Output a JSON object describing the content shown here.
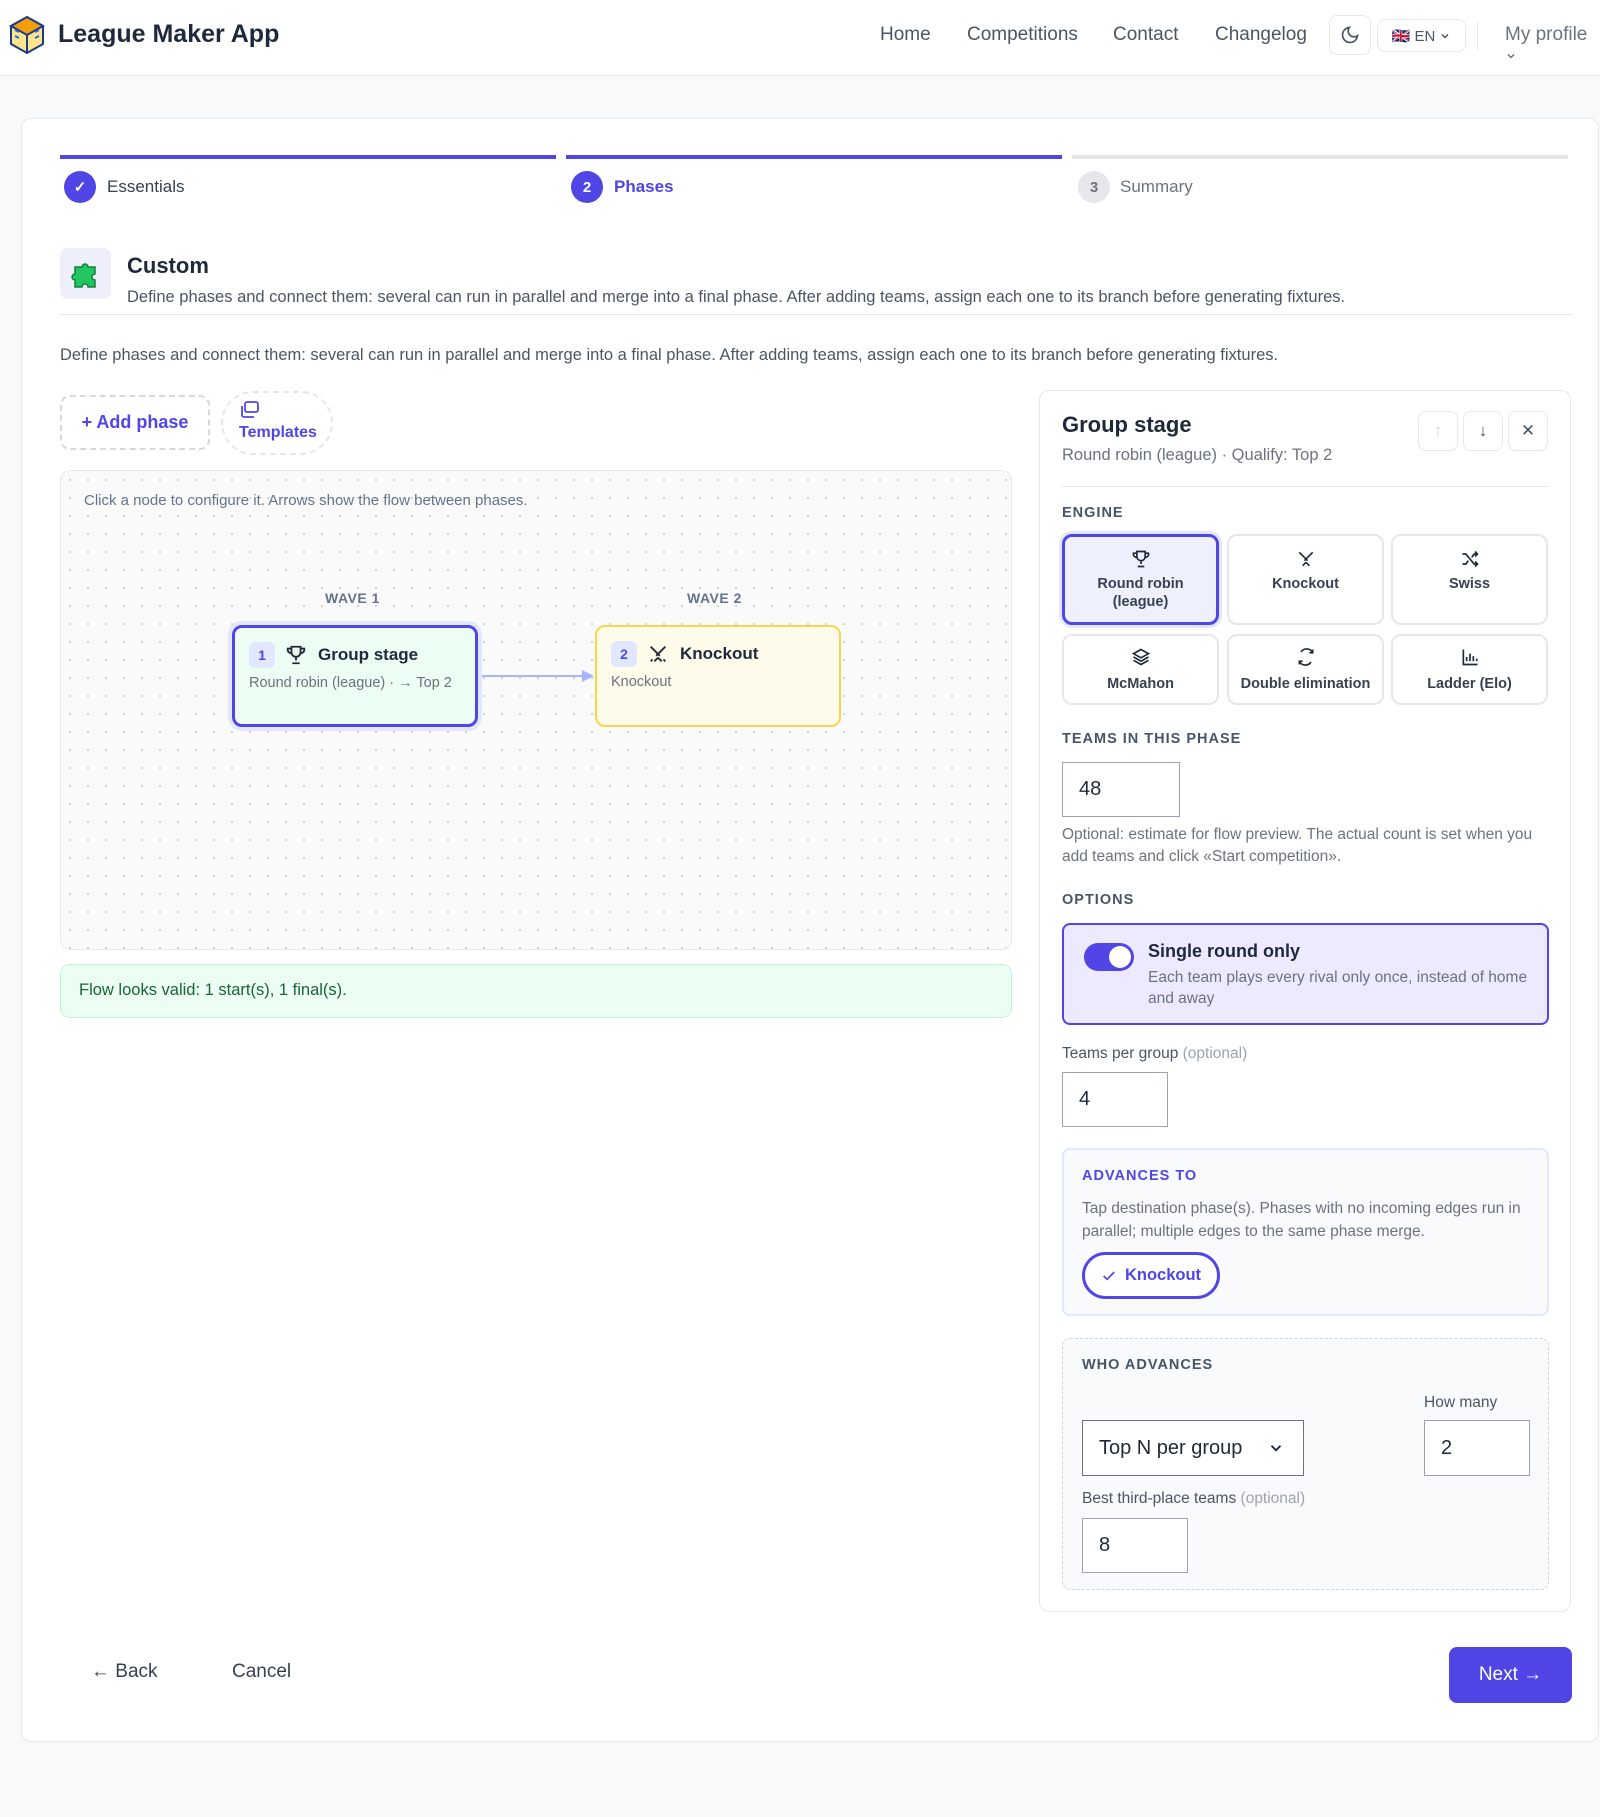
{
  "app": {
    "title": "League Maker App"
  },
  "nav": {
    "home": "Home",
    "competitions": "Competitions",
    "contact": "Contact",
    "changelog": "Changelog",
    "language": "🇬🇧 EN",
    "profile": "My profile"
  },
  "stepper": {
    "steps": [
      {
        "num": "✓",
        "label": "Essentials",
        "state": "done"
      },
      {
        "num": "2",
        "label": "Phases",
        "state": "active"
      },
      {
        "num": "3",
        "label": "Summary",
        "state": "pending"
      }
    ]
  },
  "mode": {
    "title": "Custom",
    "description": "Define phases and connect them: several can run in parallel and merge into a final phase. After adding teams, assign each one to its branch before generating fixtures."
  },
  "intro": "Define phases and connect them: several can run in parallel and merge into a final phase. After adding teams, assign each one to its branch before generating fixtures.",
  "actions": {
    "add_phase": "+ Add phase",
    "templates": "Templates"
  },
  "canvas": {
    "hint": "Click a node to configure it. Arrows show the flow between phases.",
    "waves": [
      "WAVE 1",
      "WAVE 2"
    ],
    "nodes": [
      {
        "num": "1",
        "title": "Group stage",
        "sub": "Round robin (league) · → Top 2",
        "icon": "trophy-icon"
      },
      {
        "num": "2",
        "title": "Knockout",
        "sub": "Knockout",
        "icon": "swords-icon"
      }
    ]
  },
  "validation": "Flow looks valid: 1 start(s), 1 final(s).",
  "panel": {
    "title": "Group stage",
    "subtitle": "Round robin (league) · Qualify: Top 2",
    "engine_label": "ENGINE",
    "engines": [
      "Round robin (league)",
      "Knockout",
      "Swiss",
      "McMahon",
      "Double elimination",
      "Ladder (Elo)"
    ],
    "selected_engine": "Round robin (league)",
    "teams_label": "TEAMS IN THIS PHASE",
    "teams_value": "48",
    "teams_help": "Optional: estimate for flow preview. The actual count is set when you add teams and click «Start competition».",
    "options_label": "OPTIONS",
    "single_round_title": "Single round only",
    "single_round_desc": "Each team plays every rival only once, instead of home and away",
    "single_round_on": true,
    "teams_per_group_label": "Teams per group",
    "optional": "(optional)",
    "teams_per_group_value": "4",
    "advances_label": "ADVANCES TO",
    "advances_desc": "Tap destination phase(s). Phases with no incoming edges run in parallel; multiple edges to the same phase merge.",
    "advances_chip": "Knockout",
    "who_label": "WHO ADVANCES",
    "who_select": "Top N per group",
    "how_many_label": "How many",
    "how_many_value": "2",
    "best_third_label": "Best third-place teams",
    "best_third_value": "8"
  },
  "footer": {
    "back": "← Back",
    "cancel": "Cancel",
    "next": "Next →"
  },
  "colors": {
    "accent": "#4f46e5",
    "success_bg": "#ecfdf3",
    "warning_bg": "#fffbeb"
  }
}
